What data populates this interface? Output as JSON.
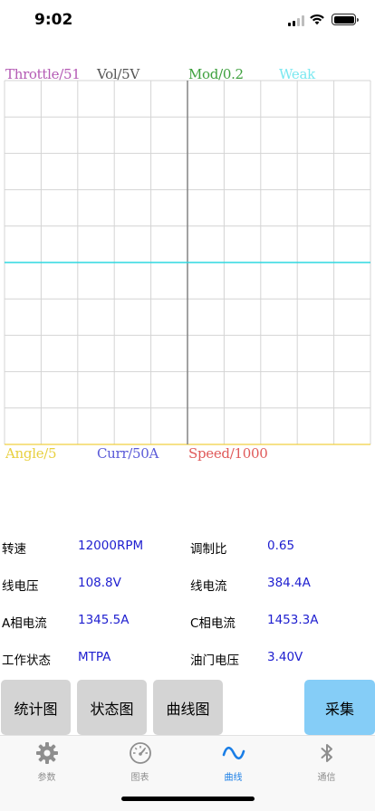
{
  "status": {
    "time": "9:02"
  },
  "chart": {
    "top_labels": [
      {
        "text": "Throttle/51",
        "color": "#b45ab4"
      },
      {
        "text": "Vol/5V",
        "color": "#555555"
      },
      {
        "text": "Mod/0.2",
        "color": "#3ea03e"
      },
      {
        "text": "Weak",
        "color": "#7ae8f0"
      }
    ],
    "bottom_labels": [
      {
        "text": "Angle/5",
        "color": "#e8d040"
      },
      {
        "text": "Curr/50A",
        "color": "#5a5ad8"
      },
      {
        "text": "Speed/1000",
        "color": "#e05a5a"
      }
    ],
    "colors": {
      "grid": "#d4d4d4",
      "zero_line": "#2ed8e0",
      "center_line": "#8a8a8a",
      "bottom_axis": "#f0d040"
    }
  },
  "readouts": [
    {
      "label": "转速",
      "value": "12000RPM",
      "label2": "调制比",
      "value2": "0.65"
    },
    {
      "label": "线电压",
      "value": "108.8V",
      "label2": "线电流",
      "value2": "384.4A"
    },
    {
      "label": "A相电流",
      "value": "1345.5A",
      "label2": "C相电流",
      "value2": "1453.3A"
    },
    {
      "label": "工作状态",
      "value": "MTPA",
      "label2": "油门电压",
      "value2": "3.40V"
    }
  ],
  "buttons": {
    "stats": "统计图",
    "state": "状态图",
    "curve": "曲线图",
    "collect": "采集"
  },
  "tabs": [
    {
      "label": "参数",
      "icon": "gear-icon"
    },
    {
      "label": "图表",
      "icon": "gauge-icon"
    },
    {
      "label": "曲线",
      "icon": "wave-icon",
      "active": true
    },
    {
      "label": "通信",
      "icon": "bluetooth-icon"
    }
  ],
  "accent": "#1a7ee6"
}
